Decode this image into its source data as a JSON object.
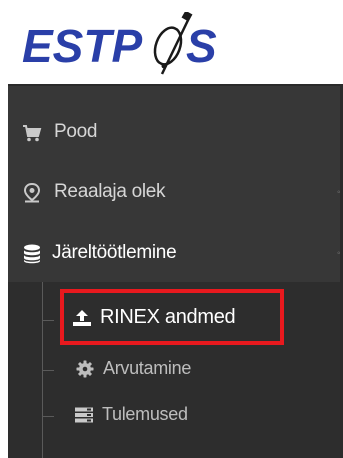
{
  "logo": {
    "text_left": "ESTP",
    "text_right": "S"
  },
  "nav": {
    "items": [
      {
        "label": "Pood",
        "icon": "cart-icon"
      },
      {
        "label": "Reaalaja olek",
        "icon": "map-marker-icon"
      },
      {
        "label": "Järeltöötlemine",
        "icon": "database-icon"
      }
    ]
  },
  "submenu": {
    "items": [
      {
        "label": "RINEX andmed",
        "icon": "upload-icon"
      },
      {
        "label": "Arvutamine",
        "icon": "gear-icon"
      },
      {
        "label": "Tulemused",
        "icon": "server-list-icon"
      }
    ]
  },
  "colors": {
    "sidebar_bg": "#373737",
    "submenu_bg": "#2d2d2d",
    "highlight_border": "#e8191e",
    "logo_blue": "#2a3fa8"
  }
}
